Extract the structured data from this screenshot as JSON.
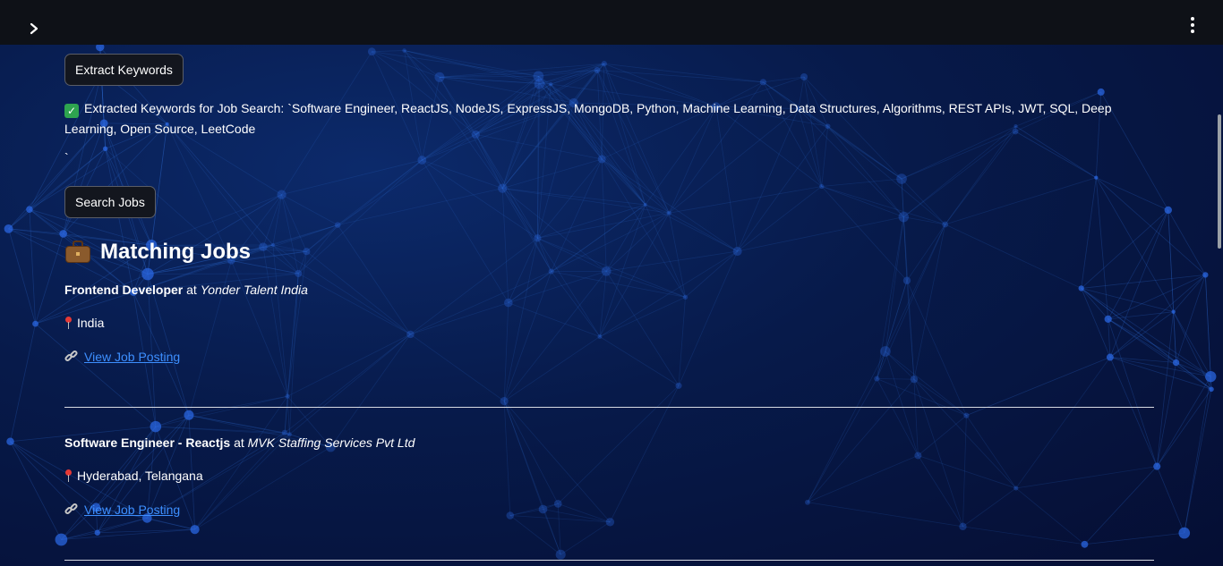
{
  "header": {
    "sidebar_toggle_icon": "chevron-right-icon",
    "menu_icon": "kebab-menu-icon"
  },
  "actions": {
    "extract_label": "Extract Keywords",
    "search_label": "Search Jobs"
  },
  "keywords": {
    "status_icon": "check-mark-icon",
    "text": "Extracted Keywords for Job Search: `Software Engineer, ReactJS, NodeJS, ExpressJS, MongoDB, Python, Machine Learning, Data Structures, Algorithms, REST APIs, JWT, SQL, Deep Learning, Open Source, LeetCode",
    "trailing": "`"
  },
  "section": {
    "icon": "briefcase-icon",
    "title": "Matching Jobs"
  },
  "jobs": [
    {
      "title": "Frontend Developer",
      "at": "at",
      "company": "Yonder Talent India",
      "location": "India",
      "link_label": "View Job Posting"
    },
    {
      "title": "Software Engineer - Reactjs",
      "at": "at",
      "company": "MVK Staffing Services Pvt Ltd",
      "location": "Hyderabad, Telangana",
      "link_label": "View Job Posting"
    }
  ],
  "colors": {
    "topbar": "#0e1117",
    "background": "#06123a",
    "link": "#3d8fff",
    "check": "#2ea44f"
  }
}
